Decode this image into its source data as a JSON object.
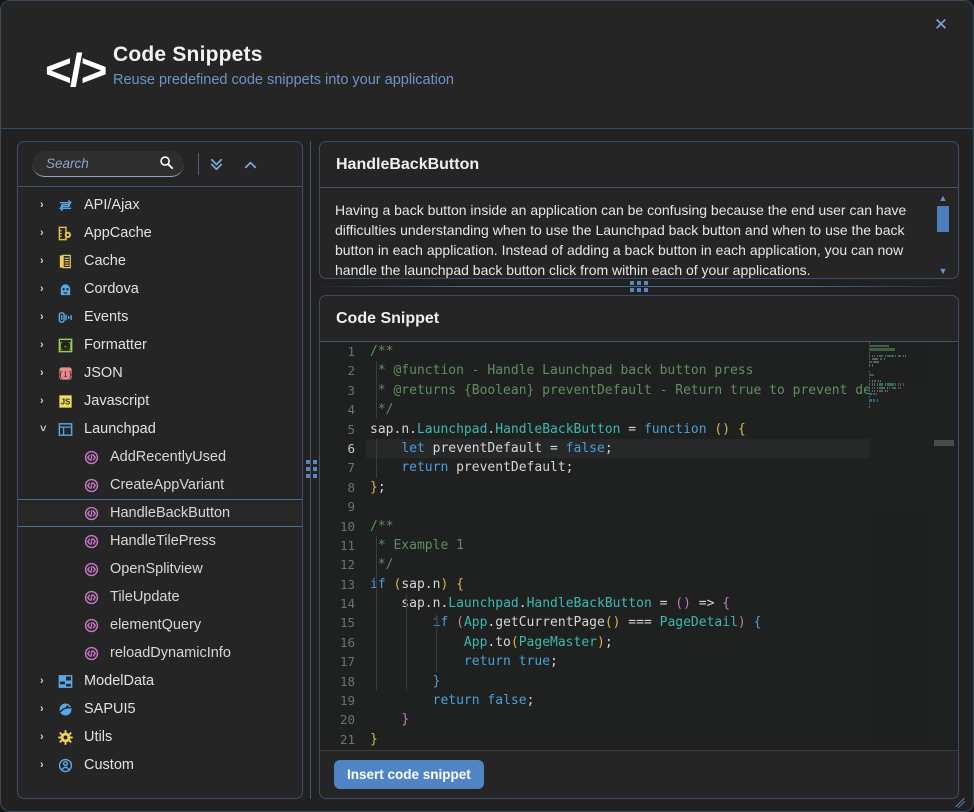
{
  "header": {
    "logo_icon": "code-brackets-icon",
    "logo_text": "</>",
    "title": "Code Snippets",
    "subtitle": "Reuse predefined code snippets into your application",
    "close_icon": "✕"
  },
  "sidebar": {
    "search": {
      "value": "",
      "placeholder": "Search",
      "icon": "search-icon"
    },
    "expand_all_icon": "»",
    "collapse_all_icon": "^",
    "tree": [
      {
        "label": "API/Ajax",
        "level": 0,
        "expanded": false,
        "arrow": "›",
        "icon": "api-ajax-icon",
        "icon_color": "#5ba8e8",
        "selected": false
      },
      {
        "label": "AppCache",
        "level": 0,
        "expanded": false,
        "arrow": "›",
        "icon": "appcache-icon",
        "icon_color": "#e5c14a",
        "selected": false
      },
      {
        "label": "Cache",
        "level": 0,
        "expanded": false,
        "arrow": "›",
        "icon": "cache-icon",
        "icon_color": "#f0cf5e",
        "selected": false
      },
      {
        "label": "Cordova",
        "level": 0,
        "expanded": false,
        "arrow": "›",
        "icon": "cordova-icon",
        "icon_color": "#5ba8e8",
        "selected": false
      },
      {
        "label": "Events",
        "level": 0,
        "expanded": false,
        "arrow": "›",
        "icon": "events-icon",
        "icon_color": "#5ba8e8",
        "selected": false
      },
      {
        "label": "Formatter",
        "level": 0,
        "expanded": false,
        "arrow": "›",
        "icon": "formatter-icon",
        "icon_color": "#9ad14a",
        "selected": false
      },
      {
        "label": "JSON",
        "level": 0,
        "expanded": false,
        "arrow": "›",
        "icon": "json-icon",
        "icon_color": "#f08a8a",
        "selected": false
      },
      {
        "label": "Javascript",
        "level": 0,
        "expanded": false,
        "arrow": "›",
        "icon": "javascript-icon",
        "icon_color": "#f0e05e",
        "selected": false
      },
      {
        "label": "Launchpad",
        "level": 0,
        "expanded": true,
        "arrow": "˅",
        "icon": "launchpad-icon",
        "icon_color": "#5ba8e8",
        "selected": false
      },
      {
        "label": "AddRecentlyUsed",
        "level": 1,
        "expanded": null,
        "arrow": "",
        "icon": "snippet-icon",
        "icon_color": "#c678c6",
        "selected": false
      },
      {
        "label": "CreateAppVariant",
        "level": 1,
        "expanded": null,
        "arrow": "",
        "icon": "snippet-icon",
        "icon_color": "#c678c6",
        "selected": false
      },
      {
        "label": "HandleBackButton",
        "level": 1,
        "expanded": null,
        "arrow": "",
        "icon": "snippet-icon",
        "icon_color": "#c678c6",
        "selected": true
      },
      {
        "label": "HandleTilePress",
        "level": 1,
        "expanded": null,
        "arrow": "",
        "icon": "snippet-icon",
        "icon_color": "#c678c6",
        "selected": false
      },
      {
        "label": "OpenSplitview",
        "level": 1,
        "expanded": null,
        "arrow": "",
        "icon": "snippet-icon",
        "icon_color": "#c678c6",
        "selected": false
      },
      {
        "label": "TileUpdate",
        "level": 1,
        "expanded": null,
        "arrow": "",
        "icon": "snippet-icon",
        "icon_color": "#c678c6",
        "selected": false
      },
      {
        "label": "elementQuery",
        "level": 1,
        "expanded": null,
        "arrow": "",
        "icon": "snippet-icon",
        "icon_color": "#c678c6",
        "selected": false
      },
      {
        "label": "reloadDynamicInfo",
        "level": 1,
        "expanded": null,
        "arrow": "",
        "icon": "snippet-icon",
        "icon_color": "#c678c6",
        "selected": false
      },
      {
        "label": "ModelData",
        "level": 0,
        "expanded": false,
        "arrow": "›",
        "icon": "modeldata-icon",
        "icon_color": "#5ba8e8",
        "selected": false
      },
      {
        "label": "SAPUI5",
        "level": 0,
        "expanded": false,
        "arrow": "›",
        "icon": "sapui5-icon",
        "icon_color": "#5ba8e8",
        "selected": false
      },
      {
        "label": "Utils",
        "level": 0,
        "expanded": false,
        "arrow": "›",
        "icon": "utils-gear-icon",
        "icon_color": "#f0cf5e",
        "selected": false
      },
      {
        "label": "Custom",
        "level": 0,
        "expanded": false,
        "arrow": "›",
        "icon": "custom-user-icon",
        "icon_color": "#5ba8e8",
        "selected": false
      }
    ]
  },
  "detail": {
    "title": "HandleBackButton",
    "description": "Having a back button inside an application can be confusing because the end user can have difficulties understanding when to use the Launchpad back button and when to use the back button in each application. Instead of adding a back button in each application, you can now handle the launchpad back button click from within each of your applications.",
    "scroll_up_icon": "▲",
    "scroll_down_icon": "▼"
  },
  "code_panel": {
    "title": "Code Snippet",
    "insert_button": "Insert code snippet",
    "line_numbers": [
      "1",
      "2",
      "3",
      "4",
      "5",
      "6",
      "7",
      "8",
      "9",
      "10",
      "11",
      "12",
      "13",
      "14",
      "15",
      "16",
      "17",
      "18",
      "19",
      "20",
      "21"
    ],
    "lines": [
      {
        "n": 1,
        "highlight": false,
        "tokens": [
          {
            "t": "/**",
            "c": "cm"
          }
        ]
      },
      {
        "n": 2,
        "highlight": false,
        "tokens": [
          {
            "t": " * @function - Handle Launchpad back button press",
            "c": "cm"
          }
        ]
      },
      {
        "n": 3,
        "highlight": false,
        "tokens": [
          {
            "t": " * @returns {Boolean} preventDefault - Return true to prevent de",
            "c": "cm"
          }
        ]
      },
      {
        "n": 4,
        "highlight": false,
        "tokens": [
          {
            "t": " */",
            "c": "cm"
          }
        ]
      },
      {
        "n": 5,
        "highlight": false,
        "tokens": [
          {
            "t": "sap",
            "c": "wh"
          },
          {
            "t": ".",
            "c": "wh"
          },
          {
            "t": "n",
            "c": "wh"
          },
          {
            "t": ".",
            "c": "wh"
          },
          {
            "t": "Launchpad",
            "c": "fn"
          },
          {
            "t": ".",
            "c": "wh"
          },
          {
            "t": "HandleBackButton",
            "c": "fn"
          },
          {
            "t": " = ",
            "c": "wh"
          },
          {
            "t": "function",
            "c": "kw"
          },
          {
            "t": " ",
            "c": "wh"
          },
          {
            "t": "()",
            "c": "yl"
          },
          {
            "t": " ",
            "c": "wh"
          },
          {
            "t": "{",
            "c": "yl"
          }
        ]
      },
      {
        "n": 6,
        "highlight": true,
        "tokens": [
          {
            "t": "    ",
            "c": "wh"
          },
          {
            "t": "let",
            "c": "kw"
          },
          {
            "t": " preventDefault = ",
            "c": "wh"
          },
          {
            "t": "false",
            "c": "kw"
          },
          {
            "t": ";",
            "c": "wh"
          }
        ]
      },
      {
        "n": 7,
        "highlight": false,
        "tokens": [
          {
            "t": "    ",
            "c": "wh"
          },
          {
            "t": "return",
            "c": "kw"
          },
          {
            "t": " preventDefault;",
            "c": "wh"
          }
        ]
      },
      {
        "n": 8,
        "highlight": false,
        "tokens": [
          {
            "t": "}",
            "c": "yl"
          },
          {
            "t": ";",
            "c": "wh"
          }
        ]
      },
      {
        "n": 9,
        "highlight": false,
        "tokens": [
          {
            "t": "",
            "c": "wh"
          }
        ]
      },
      {
        "n": 10,
        "highlight": false,
        "tokens": [
          {
            "t": "/**",
            "c": "cm"
          }
        ]
      },
      {
        "n": 11,
        "highlight": false,
        "tokens": [
          {
            "t": " * Example 1",
            "c": "cm"
          }
        ]
      },
      {
        "n": 12,
        "highlight": false,
        "tokens": [
          {
            "t": " */",
            "c": "cm"
          }
        ]
      },
      {
        "n": 13,
        "highlight": false,
        "tokens": [
          {
            "t": "if",
            "c": "kw"
          },
          {
            "t": " ",
            "c": "wh"
          },
          {
            "t": "(",
            "c": "yl"
          },
          {
            "t": "sap.n",
            "c": "wh"
          },
          {
            "t": ")",
            "c": "yl"
          },
          {
            "t": " ",
            "c": "wh"
          },
          {
            "t": "{",
            "c": "yl"
          }
        ]
      },
      {
        "n": 14,
        "highlight": false,
        "tokens": [
          {
            "t": "    sap",
            "c": "wh"
          },
          {
            "t": ".",
            "c": "wh"
          },
          {
            "t": "n",
            "c": "wh"
          },
          {
            "t": ".",
            "c": "wh"
          },
          {
            "t": "Launchpad",
            "c": "fn"
          },
          {
            "t": ".",
            "c": "wh"
          },
          {
            "t": "HandleBackButton",
            "c": "fn"
          },
          {
            "t": " = ",
            "c": "wh"
          },
          {
            "t": "()",
            "c": "pm"
          },
          {
            "t": " => ",
            "c": "wh"
          },
          {
            "t": "{",
            "c": "pm"
          }
        ]
      },
      {
        "n": 15,
        "highlight": false,
        "tokens": [
          {
            "t": "        ",
            "c": "wh"
          },
          {
            "t": "if",
            "c": "kw"
          },
          {
            "t": " ",
            "c": "wh"
          },
          {
            "t": "(",
            "c": "pm"
          },
          {
            "t": "App",
            "c": "fn"
          },
          {
            "t": ".",
            "c": "wh"
          },
          {
            "t": "getCurrentPage",
            "c": "wh"
          },
          {
            "t": "()",
            "c": "yl"
          },
          {
            "t": " === ",
            "c": "wh"
          },
          {
            "t": "PageDetail",
            "c": "fn"
          },
          {
            "t": ")",
            "c": "pm"
          },
          {
            "t": " ",
            "c": "wh"
          },
          {
            "t": "{",
            "c": "kw"
          }
        ]
      },
      {
        "n": 16,
        "highlight": false,
        "tokens": [
          {
            "t": "            ",
            "c": "wh"
          },
          {
            "t": "App",
            "c": "fn"
          },
          {
            "t": ".",
            "c": "wh"
          },
          {
            "t": "to",
            "c": "wh"
          },
          {
            "t": "(",
            "c": "yl"
          },
          {
            "t": "PageMaster",
            "c": "fn"
          },
          {
            "t": ")",
            "c": "yl"
          },
          {
            "t": ";",
            "c": "wh"
          }
        ]
      },
      {
        "n": 17,
        "highlight": false,
        "tokens": [
          {
            "t": "            ",
            "c": "wh"
          },
          {
            "t": "return",
            "c": "kw"
          },
          {
            "t": " ",
            "c": "wh"
          },
          {
            "t": "true",
            "c": "kw"
          },
          {
            "t": ";",
            "c": "wh"
          }
        ]
      },
      {
        "n": 18,
        "highlight": false,
        "tokens": [
          {
            "t": "        ",
            "c": "wh"
          },
          {
            "t": "}",
            "c": "kw"
          }
        ]
      },
      {
        "n": 19,
        "highlight": false,
        "tokens": [
          {
            "t": "        ",
            "c": "wh"
          },
          {
            "t": "return",
            "c": "kw"
          },
          {
            "t": " ",
            "c": "wh"
          },
          {
            "t": "false",
            "c": "kw"
          },
          {
            "t": ";",
            "c": "wh"
          }
        ]
      },
      {
        "n": 20,
        "highlight": false,
        "tokens": [
          {
            "t": "    ",
            "c": "wh"
          },
          {
            "t": "}",
            "c": "pm"
          }
        ]
      },
      {
        "n": 21,
        "highlight": false,
        "tokens": [
          {
            "t": "}",
            "c": "yl"
          }
        ]
      }
    ]
  },
  "colors": {
    "dialog_bg": "#212121",
    "panel_bg": "#252525",
    "editor_bg": "#1f2020",
    "accent_blue": "#5084c4",
    "border_blue": "#3b4e68",
    "comment_green": "#5f8f5f",
    "keyword_blue": "#4a9fd8",
    "function_teal": "#3bb9b0",
    "bracket_yellow": "#d8b546",
    "bracket_magenta": "#c678c6"
  }
}
